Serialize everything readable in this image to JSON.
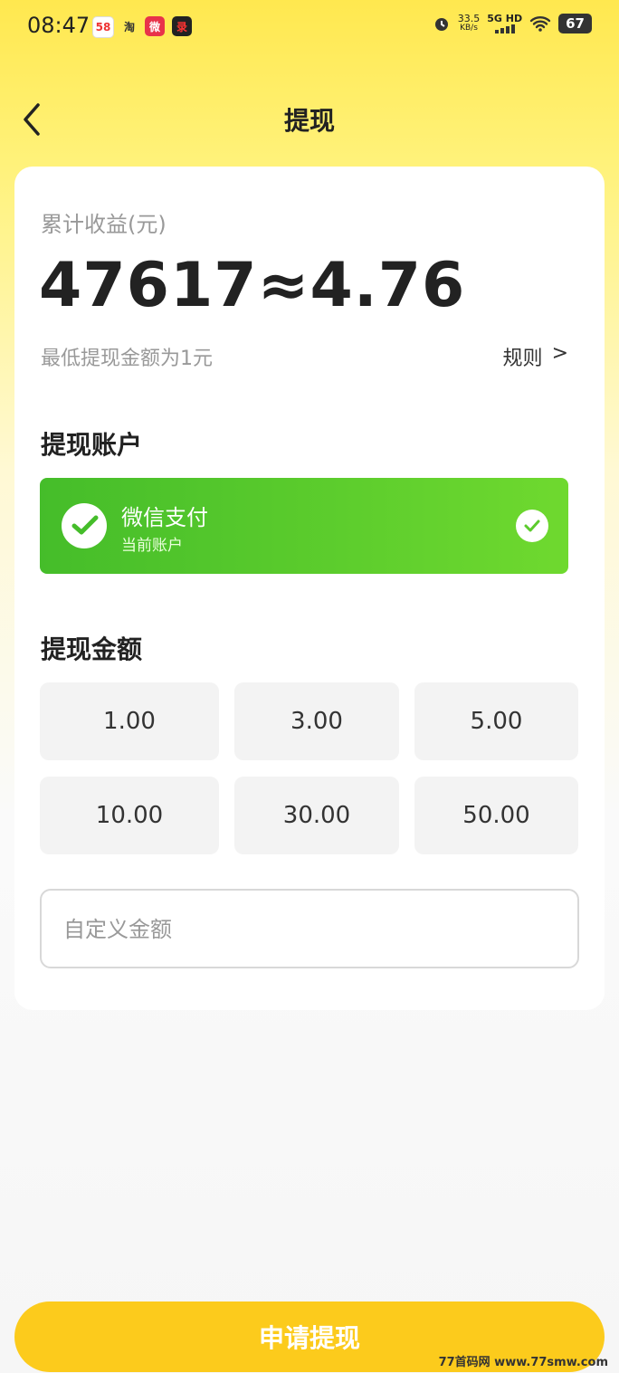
{
  "status_bar": {
    "time": "08:47",
    "app_icons": [
      "58",
      "淘",
      "微",
      "录"
    ],
    "speed_value": "33.5",
    "speed_unit": "KB/s",
    "network": "5G HD",
    "battery": "67"
  },
  "nav": {
    "title": "提现"
  },
  "earnings": {
    "label": "累计收益(元)",
    "amount": "47617≈4.76",
    "min_note": "最低提现金额为1元",
    "rules_label": "规则",
    "rules_arrow": ">"
  },
  "account": {
    "section_title": "提现账户",
    "name": "微信支付",
    "sub": "当前账户"
  },
  "amounts": {
    "section_title": "提现金额",
    "options": [
      "1.00",
      "3.00",
      "5.00",
      "10.00",
      "30.00",
      "50.00"
    ],
    "custom_placeholder": "自定义金额"
  },
  "submit_label": "申请提现",
  "watermark": "77首码网 www.77smw.com",
  "colors": {
    "accent": "#fccb1c",
    "wechat_green": "#45bd2a"
  }
}
